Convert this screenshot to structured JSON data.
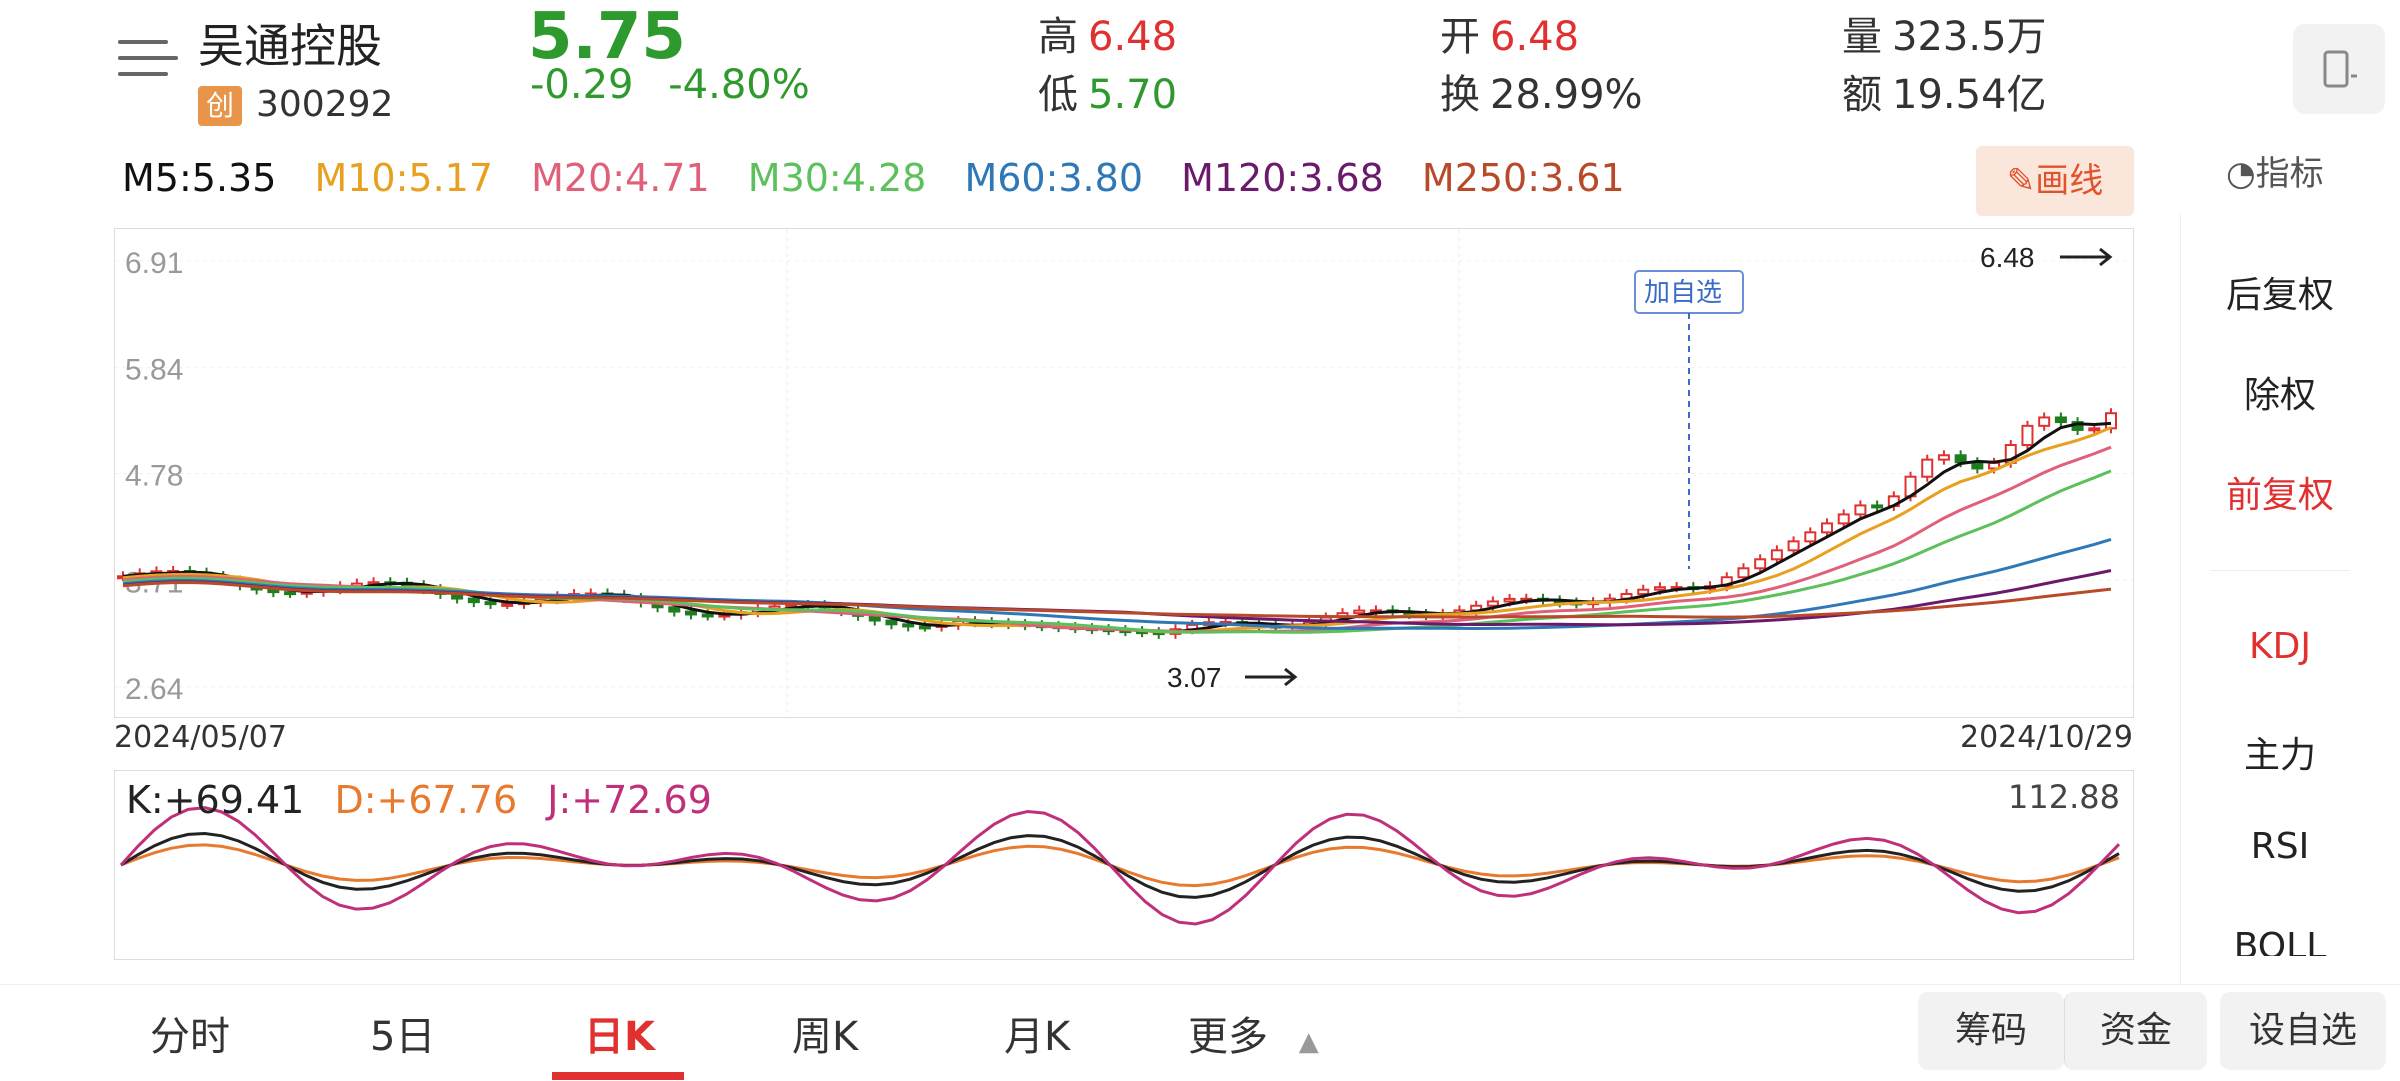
{
  "header": {
    "stock_name": "吴通控股",
    "board_badge": "创",
    "stock_code": "300292",
    "price": "5.75",
    "change": "-0.29",
    "change_pct": "-4.80%",
    "high_label": "高",
    "high_value": "6.48",
    "low_label": "低",
    "low_value": "5.70",
    "open_label": "开",
    "open_value": "6.48",
    "turnover_label": "换",
    "turnover_value": "28.99%",
    "volume_label": "量",
    "volume_value": "323.5万",
    "amount_label": "额",
    "amount_value": "19.54亿"
  },
  "ma": {
    "m5": "M5:5.35",
    "m10": "M10:5.17",
    "m20": "M20:4.71",
    "m30": "M30:4.28",
    "m60": "M60:3.80",
    "m120": "M120:3.68",
    "m250": "M250:3.61"
  },
  "ma_colors": {
    "m5": "#111111",
    "m10": "#e8a020",
    "m20": "#e0607a",
    "m30": "#5cc05c",
    "m60": "#2f78b8",
    "m120": "#6b1a6b",
    "m250": "#b84a2a"
  },
  "toolbar": {
    "draw_label": "画线",
    "indicator_label": "指标"
  },
  "chart": {
    "y_labels": [
      "6.91",
      "5.84",
      "4.78",
      "3.71",
      "2.64"
    ],
    "date_start": "2024/05/07",
    "date_end": "2024/10/29",
    "max_marker": "6.48",
    "min_marker": "3.07",
    "watchlist_marker": "加自选"
  },
  "kdj": {
    "k": "K:+69.41",
    "d": "D:+67.76",
    "j": "J:+72.69",
    "max": "112.88"
  },
  "side": {
    "items": [
      "后复权",
      "除权",
      "前复权",
      "KDJ",
      "主力",
      "RSI",
      "BOLL"
    ]
  },
  "tabs": [
    "分时",
    "5日",
    "日K",
    "周K",
    "月K",
    "更多"
  ],
  "actions": {
    "chips": "筹码",
    "funds": "资金",
    "add_watch": "设自选"
  }
}
